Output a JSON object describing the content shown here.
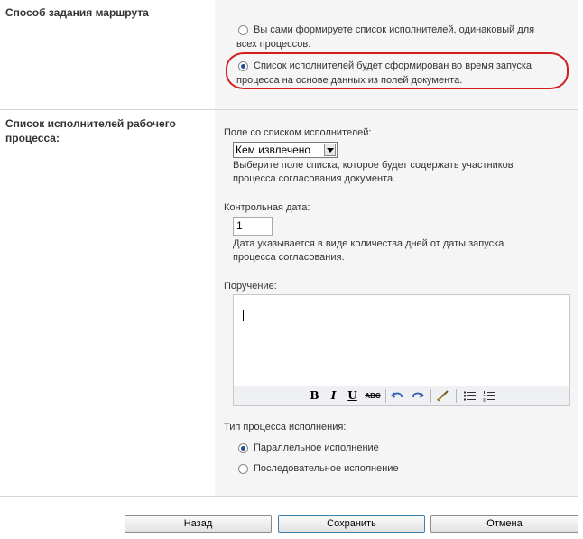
{
  "route_section": {
    "title": "Способ задания маршрута",
    "option_manual": {
      "line1": "Вы сами формируете список исполнителей, одинаковый для",
      "line2": "всех процессов.",
      "selected": false
    },
    "option_auto": {
      "line1": "Список исполнителей будет сформирован во время запуска",
      "line2": "процесса на основе данных из полей документа.",
      "selected": true
    }
  },
  "executors_section": {
    "title_line1": "Список исполнителей рабочего",
    "title_line2": "процесса:",
    "field_label": "Поле со списком исполнителей:",
    "field_value": "Кем извлечено",
    "field_help_line1": "Выберите поле списка, которое будет содержать участников",
    "field_help_line2": "процесса согласования документа.",
    "due_label": "Контрольная дата:",
    "due_value": "1",
    "due_help_line1": "Дата указывается в виде количества дней от даты запуска",
    "due_help_line2": "процесса согласования.",
    "task_label": "Поручение:",
    "toolbar": {
      "bold": "B",
      "italic": "I",
      "underline": "U",
      "strike": "ABC"
    },
    "exec_type_label": "Тип процесса исполнения:",
    "exec_parallel": {
      "label": "Параллельное исполнение",
      "selected": true
    },
    "exec_sequential": {
      "label": "Последовательное исполнение",
      "selected": false
    }
  },
  "buttons": {
    "back": "Назад",
    "save": "Сохранить",
    "cancel": "Отмена"
  },
  "colors": {
    "highlight": "#d21e1e",
    "panel": "#f5f5f5"
  }
}
